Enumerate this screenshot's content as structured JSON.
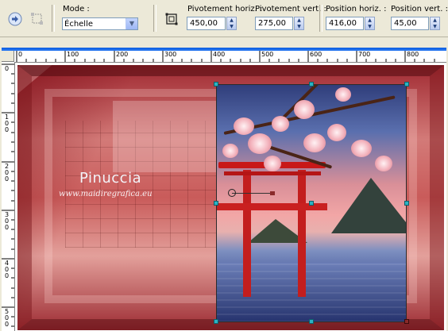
{
  "toolbar": {
    "mode": {
      "label": "Mode :",
      "value": "Échelle"
    },
    "pivot_h": {
      "label": "Pivotement horiz. :",
      "value": "450,00"
    },
    "pivot_v": {
      "label": "Pivotement vert. :",
      "value": "275,00"
    },
    "pos_h": {
      "label": "Position horiz. :",
      "value": "416,00"
    },
    "pos_v": {
      "label": "Position vert. :",
      "value": "45,00"
    },
    "icons": [
      "apply-icon",
      "deform-icon",
      "pick-tool-icon"
    ]
  },
  "ruler": {
    "top_ticks": [
      "0",
      "100",
      "200",
      "300",
      "400",
      "500",
      "600",
      "700",
      "800"
    ],
    "left_ticks": [
      "0",
      "1 0 0",
      "2 0 0",
      "3 0 0",
      "4 0 0",
      "5 0 0"
    ]
  },
  "canvas": {
    "watermark_name": "Pinuccia",
    "watermark_url": "www.maidiregrafica.eu"
  },
  "colors": {
    "selection_handle": "#2bb3c3",
    "torii_red": "#c81818",
    "background_red": "#c95b5a"
  }
}
